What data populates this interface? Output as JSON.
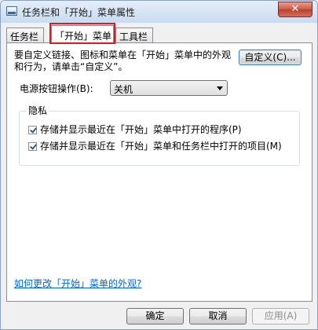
{
  "window": {
    "title": "任务栏和「开始」菜单属性",
    "close_glyph": "✕"
  },
  "tabs": [
    {
      "label": "任务栏",
      "active": false
    },
    {
      "label": "「开始」菜单",
      "active": true
    },
    {
      "label": "工具栏",
      "active": false
    }
  ],
  "start_menu": {
    "description": "要自定义链接、图标和菜单在「开始」菜单中的外观和行为，请单击“自定义”。",
    "customize_label": "自定义(C)...",
    "power_label": "电源按钮操作(B):",
    "power_value": "关机"
  },
  "privacy": {
    "title": "隐私",
    "options": [
      {
        "label": "存储并显示最近在「开始」菜单中打开的程序(P)",
        "checked": true
      },
      {
        "label": "存储并显示最近在「开始」菜单和任务栏中打开的项目(M)",
        "checked": true
      }
    ]
  },
  "help_link": "如何更改「开始」菜单的外观?",
  "buttons": {
    "ok": "确定",
    "cancel": "取消",
    "apply": "应用(A)"
  },
  "colors": {
    "highlight": "#e01a1a",
    "link": "#0066cc"
  }
}
